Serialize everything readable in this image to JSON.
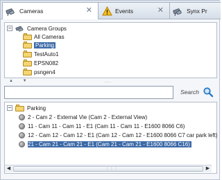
{
  "tabs": [
    {
      "label": "Cameras",
      "icon": "camera-group-icon",
      "active": true
    },
    {
      "label": "Events",
      "icon": "warning-icon",
      "active": false
    },
    {
      "label": "Synx Pr",
      "icon": "camera-group-icon",
      "active": false
    }
  ],
  "camera_groups": {
    "root_label": "Camera Groups",
    "expander": "−",
    "items": [
      {
        "label": "All Cameras",
        "selected": false
      },
      {
        "label": "Parking",
        "selected": true
      },
      {
        "label": "TestAuto1",
        "selected": false
      },
      {
        "label": "EPSN082",
        "selected": false
      },
      {
        "label": "psngen4",
        "selected": false
      }
    ]
  },
  "splitter": {
    "arrows": "▲ ▼",
    "grip": "·····"
  },
  "search": {
    "value": "",
    "placeholder": "",
    "label": "Search"
  },
  "camera_list": {
    "root_label": "Parking",
    "expander": "−",
    "items": [
      {
        "label": "2 - Cam 2 - External Vie (Cam 2 - External View)",
        "selected": false
      },
      {
        "label": "11 - Cam 11 - Cam 11 - E1 (Cam 11 - Cam 11 - E1600 8066 C6)",
        "selected": false
      },
      {
        "label": "12 - Cam 12 - Cam 12 - E1 (Cam 12 - Cam 12 - E1600 8066 C7 car park left)",
        "selected": false
      },
      {
        "label": "21 - Cam 21 - Cam 21 - E1 (Cam 21 - Cam 21 - E1600 8066 C16)",
        "selected": true
      }
    ]
  },
  "scrollbar": {
    "left": "◀",
    "right": "▶",
    "grip": "⋮⋮⋮"
  },
  "colors": {
    "selection": "#3c6aa7",
    "folder": "#f3d572"
  }
}
